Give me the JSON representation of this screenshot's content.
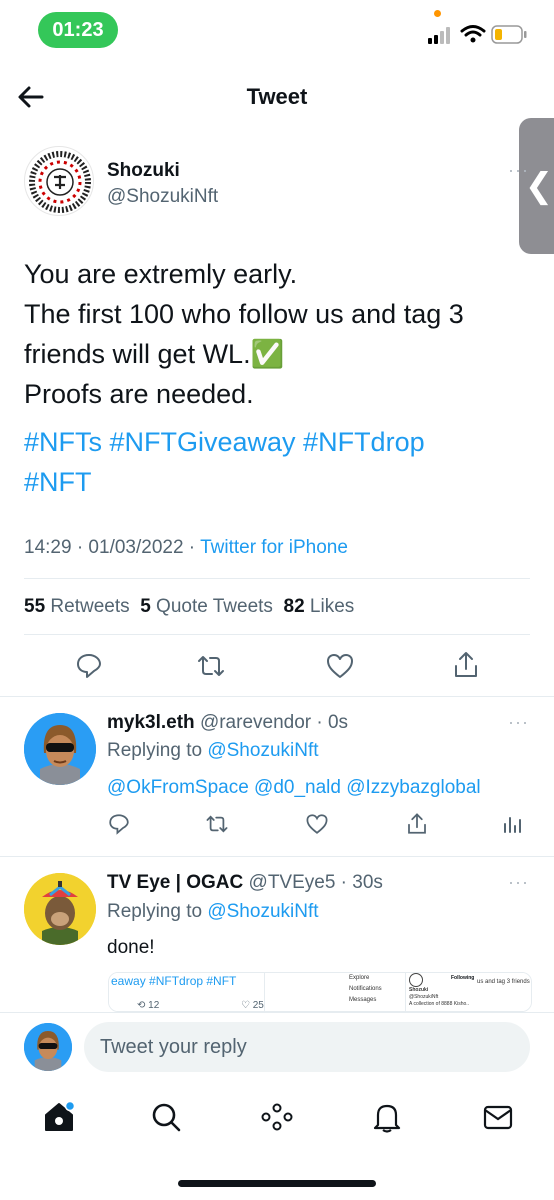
{
  "status_bar": {
    "time": "01:23"
  },
  "header": {
    "title": "Tweet"
  },
  "main_tweet": {
    "author_name": "Shozuki",
    "author_handle": "@ShozukiNft",
    "text_lines": [
      "You are extremly early.",
      "The first 100 who follow us and tag 3",
      "friends will get WL.✅",
      "Proofs are needed."
    ],
    "hashtags_line1": "#NFTs #NFTGiveaway #NFTdrop",
    "hashtags_line2": "#NFT",
    "time": "14:29 · 01/03/2022 · ",
    "source": "Twitter for iPhone",
    "stats": {
      "retweets_count": "55",
      "retweets_label": "Retweets",
      "quotes_count": "5",
      "quotes_label": "Quote Tweets",
      "likes_count": "82",
      "likes_label": "Likes"
    }
  },
  "replies": [
    {
      "name": "myk3l.eth",
      "handle_time": "@rarevendor · 0s",
      "replying_prefix": "Replying to ",
      "replying_to": "@ShozukiNft",
      "mentions": "@OkFromSpace @d0_nald @Izzybazglobal"
    },
    {
      "name": "TV Eye | OGAC",
      "handle_time": "@TVEye5 · 30s",
      "replying_prefix": "Replying to ",
      "replying_to": "@ShozukiNft",
      "text": "done!",
      "embed": {
        "left_text": "eaway #NFTdrop #NFT",
        "retweets": "12",
        "likes": "25",
        "menu": [
          "Explore",
          "Notifications",
          "Messages"
        ],
        "profile_name": "Shozuki",
        "profile_handle": "@ShozukiNft",
        "following": "Following",
        "bio": "A collection of 8888 Kisho..",
        "right_text": "us and tag 3 friends"
      }
    }
  ],
  "reply_bar": {
    "placeholder": "Tweet your reply"
  },
  "colors": {
    "accent": "#1d9bf0",
    "status_green": "#34c759"
  }
}
